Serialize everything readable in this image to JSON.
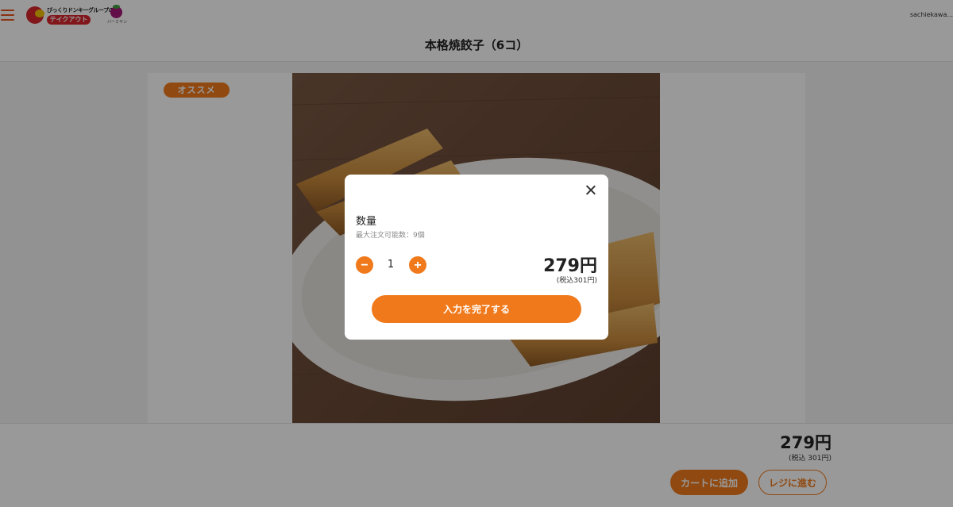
{
  "header": {
    "logo_top_text": "びっくりドンキーグループの",
    "logo_pill_text": "テイクアウト",
    "logo_sub_text": "バーミヤン",
    "user_name": "sachiekawa... "
  },
  "page": {
    "title": "本格焼餃子（6コ）"
  },
  "product": {
    "badge": "オススメ"
  },
  "footer": {
    "price": "279円",
    "tax_price": "(税込 301円)",
    "add_to_cart": "カートに追加",
    "checkout": "レジに進む"
  },
  "modal": {
    "quantity_label": "数量",
    "max_order": "最大注文可能数：9個",
    "minus_symbol": "−",
    "plus_symbol": "+",
    "quantity": "1",
    "price": "279円",
    "tax_price": "(税込301円)",
    "complete_button": "入力を完了する"
  },
  "colors": {
    "accent": "#f07a1b",
    "overlay": "rgba(0,0,0,0.4)"
  }
}
